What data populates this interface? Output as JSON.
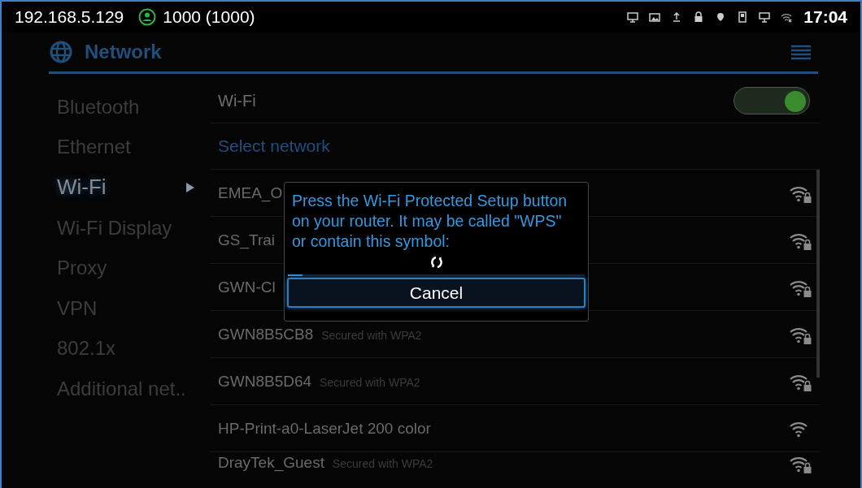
{
  "status_bar": {
    "ip": "192.168.5.129",
    "account": "1000 (1000)",
    "time": "17:04"
  },
  "header": {
    "title": "Network"
  },
  "sidebar": {
    "items": [
      {
        "label": "Bluetooth",
        "selected": false
      },
      {
        "label": "Ethernet",
        "selected": false
      },
      {
        "label": "Wi-Fi",
        "selected": true
      },
      {
        "label": "Wi-Fi Display",
        "selected": false
      },
      {
        "label": "Proxy",
        "selected": false
      },
      {
        "label": "VPN",
        "selected": false
      },
      {
        "label": "802.1x",
        "selected": false
      },
      {
        "label": "Additional net..",
        "selected": false
      }
    ]
  },
  "wifi_toggle": {
    "label": "Wi-Fi",
    "on": true
  },
  "section_title": "Select network",
  "networks": [
    {
      "name": "EMEA_O",
      "secured": true
    },
    {
      "name": "GS_Trai",
      "secured": true
    },
    {
      "name": "GWN-Cl",
      "secured": true
    },
    {
      "name": "GWN8B5CB8",
      "security": "Secured with WPA2",
      "secured": true
    },
    {
      "name": "GWN8B5D64",
      "security": "Secured with WPA2",
      "secured": true
    },
    {
      "name": "HP-Print-a0-LaserJet 200 color",
      "secured": false
    },
    {
      "name": "DrayTek_Guest",
      "security": "Secured with WPA2",
      "secured": true
    }
  ],
  "dialog": {
    "message": "Press the Wi-Fi Protected Setup button on your router. It may be called \"WPS\" or contain this symbol:",
    "level": 0.05,
    "button": "Cancel"
  }
}
